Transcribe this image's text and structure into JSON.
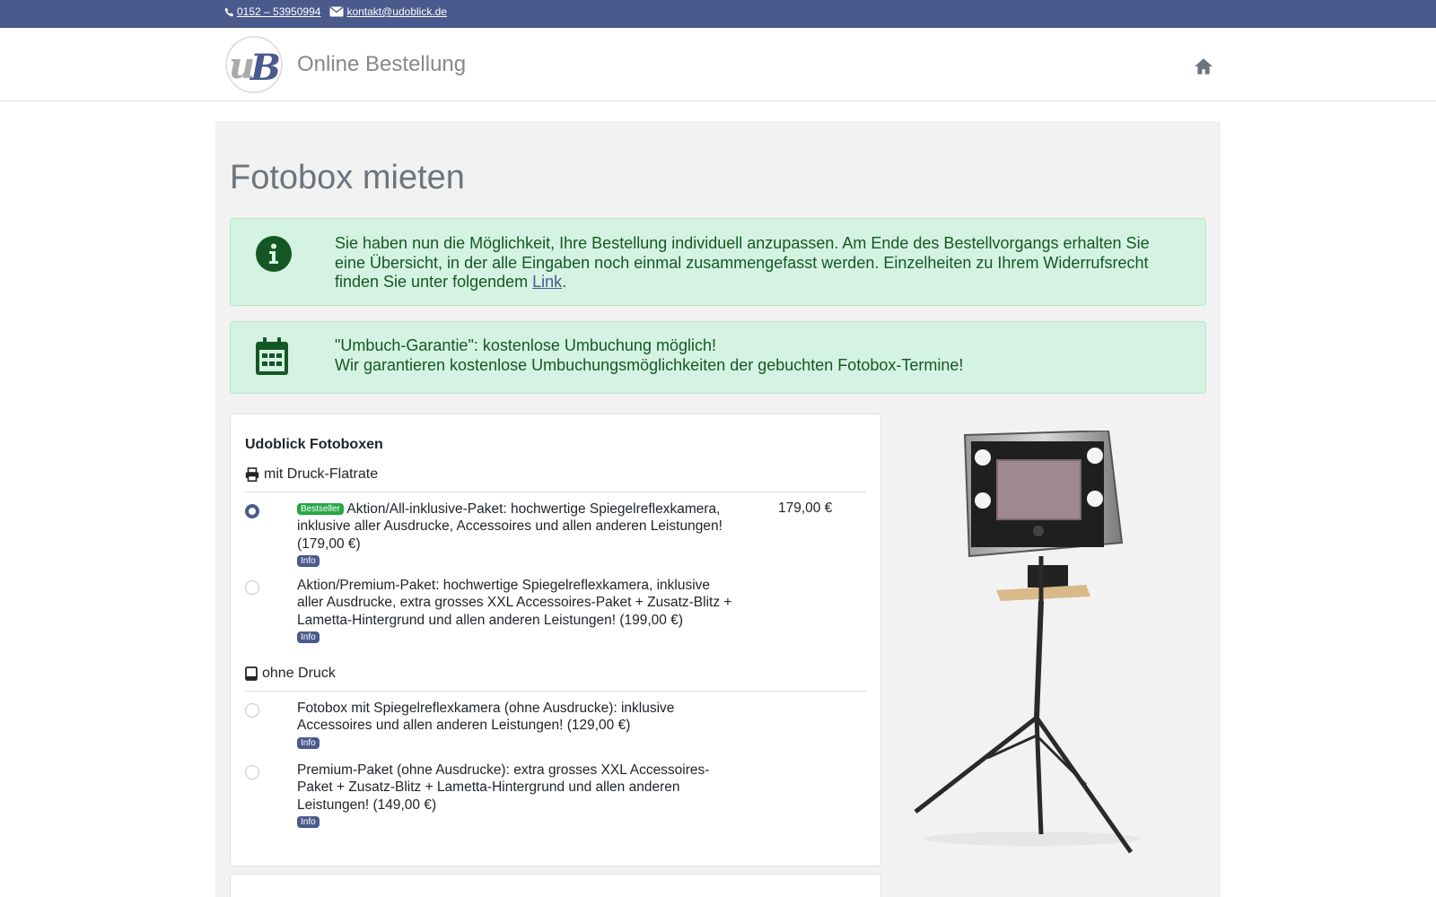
{
  "topbar": {
    "phone": "0152 – 53950994",
    "email": "kontakt@udoblick.de"
  },
  "navbar": {
    "logo_text": "uB",
    "title": "Online Bestellung"
  },
  "page": {
    "title": "Fotobox mieten"
  },
  "alerts": {
    "info_text": "Sie haben nun die Möglichkeit, Ihre Bestellung individuell anzupassen. Am Ende des Bestellvorgangs erhalten Sie eine Übersicht, in der alle Eingaben noch einmal zusammengefasst werden. Einzelheiten zu Ihrem Widerrufsrecht finden Sie unter folgendem ",
    "info_link": "Link",
    "info_end": ".",
    "guarantee_line1": "\"Umbuch-Garantie\": kostenlose Umbuchung möglich!",
    "guarantee_line2": "Wir garantieren kostenlose Umbuchungsmöglichkeiten der gebuchten Fotobox-Termine!"
  },
  "card": {
    "title": "Udoblick Fotoboxen",
    "group_print": "mit Druck-Flatrate",
    "group_noprint": "ohne Druck",
    "badge_bestseller": "Bestseller",
    "badge_info": "Info",
    "options": [
      {
        "label": "Aktion/All-inklusive-Paket: hochwertige Spiegelreflexkamera, inklusive aller Ausdrucke, Accessoires und allen anderen Leistungen! (179,00 €)",
        "price": "179,00 €",
        "selected": true
      },
      {
        "label": "Aktion/Premium-Paket: hochwertige Spiegelreflexkamera, inklusive aller Ausdrucke, extra grosses XXL Accessoires-Paket + Zusatz-Blitz + Lametta-Hintergrund und allen anderen Leistungen! (199,00 €)",
        "selected": false
      },
      {
        "label": "Fotobox mit Spiegelreflexkamera (ohne Ausdrucke): inklusive Accessoires und allen anderen Leistungen! (129,00 €)",
        "selected": false
      },
      {
        "label": "Premium-Paket (ohne Ausdrucke): extra grosses XXL Accessoires-Paket + Zusatz-Blitz + Lametta-Hintergrund und allen anderen Leistungen! (149,00 €)",
        "selected": false
      }
    ]
  },
  "icons": {
    "phone": "phone-icon",
    "email": "envelope-icon",
    "home": "home-icon",
    "info": "info-circle-icon",
    "calendar": "calendar-icon",
    "printer": "printer-icon",
    "tablet": "tablet-icon"
  },
  "colors": {
    "topbar": "#4a5a8c",
    "alert_bg": "#d4f3e2",
    "alert_text": "#155724",
    "badge_green": "#28a745",
    "badge_info": "#4a5a8c"
  }
}
